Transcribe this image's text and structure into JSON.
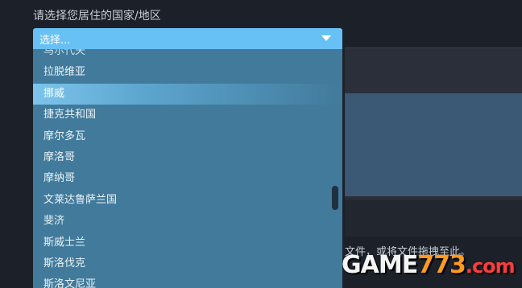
{
  "country_field": {
    "label": "请选择您居住的国家/地区",
    "selected_display": "选择...",
    "options": [
      {
        "label": "马尔代夫",
        "state": "partially-visible"
      },
      {
        "label": "拉脱维亚",
        "state": "normal"
      },
      {
        "label": "挪威",
        "state": "highlighted"
      },
      {
        "label": "捷克共和国",
        "state": "normal"
      },
      {
        "label": "摩尔多瓦",
        "state": "normal"
      },
      {
        "label": "摩洛哥",
        "state": "normal"
      },
      {
        "label": "摩纳哥",
        "state": "normal"
      },
      {
        "label": "文莱达鲁萨兰国",
        "state": "normal"
      },
      {
        "label": "斐济",
        "state": "normal"
      },
      {
        "label": "斯威士兰",
        "state": "normal"
      },
      {
        "label": "斯洛伐克",
        "state": "normal"
      },
      {
        "label": "斯洛文尼亚",
        "state": "normal"
      }
    ]
  },
  "upload_hint": "文件，或将文件拖拽至此。",
  "watermark": {
    "part1": "GAME",
    "part2": "773",
    "part3": ".com"
  },
  "colors": {
    "background": "#1b2029",
    "select_header": "#67c1f5",
    "dropdown_list": "#417a9b",
    "highlight": "#7cc4ec",
    "text_light": "#c7cdd3"
  },
  "icons": {
    "caret": "caret-down-icon"
  }
}
